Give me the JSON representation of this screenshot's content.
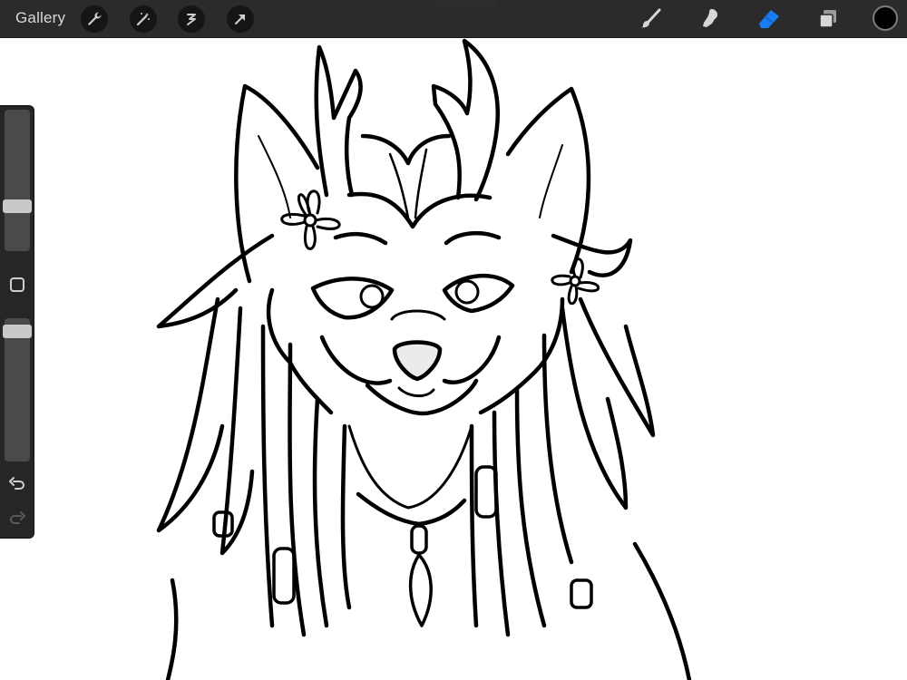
{
  "toolbar": {
    "gallery_label": "Gallery",
    "left_tools": [
      "wrench-icon",
      "magic-wand-icon",
      "selection-icon",
      "transform-arrow-icon"
    ],
    "right_tools": [
      "brush-icon",
      "smudge-icon",
      "eraser-icon",
      "layers-icon"
    ],
    "active_tool": "eraser",
    "current_color": "#000000",
    "accent_color": "#1a7cf5"
  },
  "sidebar": {
    "brush_size_level": 0.3,
    "opacity_level": 0.95,
    "icons": [
      "square-modify-icon",
      "undo-icon",
      "redo-icon"
    ]
  }
}
